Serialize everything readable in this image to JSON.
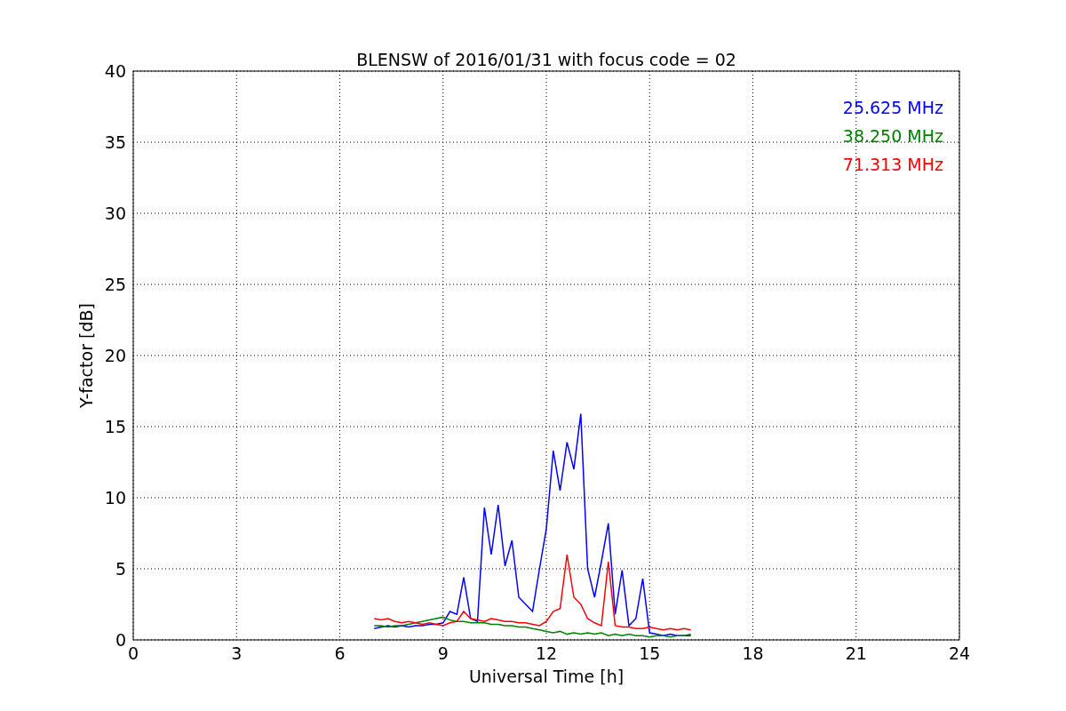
{
  "chart_data": {
    "type": "line",
    "title": "BLENSW of 2016/01/31 with focus code = 02",
    "xlabel": "Universal Time [h]",
    "ylabel": "Y-factor [dB]",
    "x": [
      7.0,
      7.2,
      7.4,
      7.6,
      7.8,
      8.0,
      8.2,
      8.4,
      8.6,
      8.8,
      9.0,
      9.2,
      9.4,
      9.6,
      9.8,
      10.0,
      10.2,
      10.4,
      10.6,
      10.8,
      11.0,
      11.2,
      11.4,
      11.6,
      11.8,
      12.0,
      12.2,
      12.4,
      12.6,
      12.8,
      13.0,
      13.2,
      13.4,
      13.6,
      13.8,
      14.0,
      14.2,
      14.4,
      14.6,
      14.8,
      15.0,
      15.2,
      15.4,
      15.6,
      15.8,
      16.0,
      16.2
    ],
    "series": [
      {
        "name": "25.625 MHz",
        "color": "#0000ff",
        "values": [
          0.8,
          0.9,
          1.0,
          0.9,
          1.0,
          0.9,
          1.0,
          1.0,
          1.1,
          1.1,
          1.2,
          2.0,
          1.8,
          4.4,
          1.5,
          1.3,
          9.3,
          6.0,
          9.5,
          5.2,
          7.0,
          3.0,
          2.5,
          2.0,
          5.0,
          7.8,
          13.3,
          10.5,
          13.9,
          12.0,
          15.9,
          5.0,
          3.0,
          5.5,
          8.2,
          1.8,
          4.9,
          1.0,
          1.5,
          4.3,
          0.5,
          0.4,
          0.3,
          0.4,
          0.3,
          0.3,
          0.3
        ]
      },
      {
        "name": "38.250 MHz",
        "color": "#008000",
        "values": [
          1.0,
          1.0,
          0.9,
          1.0,
          1.0,
          1.1,
          1.2,
          1.3,
          1.4,
          1.5,
          1.6,
          1.4,
          1.3,
          1.3,
          1.2,
          1.2,
          1.2,
          1.1,
          1.1,
          1.0,
          1.0,
          0.9,
          0.9,
          0.8,
          0.7,
          0.6,
          0.5,
          0.6,
          0.4,
          0.5,
          0.4,
          0.5,
          0.4,
          0.5,
          0.3,
          0.4,
          0.3,
          0.4,
          0.3,
          0.3,
          0.2,
          0.3,
          0.3,
          0.2,
          0.3,
          0.3,
          0.4
        ]
      },
      {
        "name": "71.313 MHz",
        "color": "#ff0000",
        "values": [
          1.5,
          1.4,
          1.5,
          1.3,
          1.2,
          1.3,
          1.2,
          1.1,
          1.2,
          1.1,
          1.0,
          1.2,
          1.3,
          2.0,
          1.5,
          1.4,
          1.3,
          1.5,
          1.4,
          1.3,
          1.3,
          1.2,
          1.2,
          1.1,
          1.0,
          1.3,
          2.0,
          2.2,
          6.0,
          3.0,
          2.5,
          1.5,
          1.2,
          1.0,
          5.5,
          1.0,
          0.9,
          0.9,
          0.8,
          0.8,
          0.9,
          0.8,
          0.7,
          0.8,
          0.7,
          0.8,
          0.7
        ]
      }
    ],
    "grid": true,
    "xlim": [
      0,
      24
    ],
    "ylim": [
      0,
      40
    ],
    "xticks": [
      0,
      3,
      6,
      9,
      12,
      15,
      18,
      21,
      24
    ],
    "yticks": [
      0,
      5,
      10,
      15,
      20,
      25,
      30,
      35,
      40
    ]
  }
}
